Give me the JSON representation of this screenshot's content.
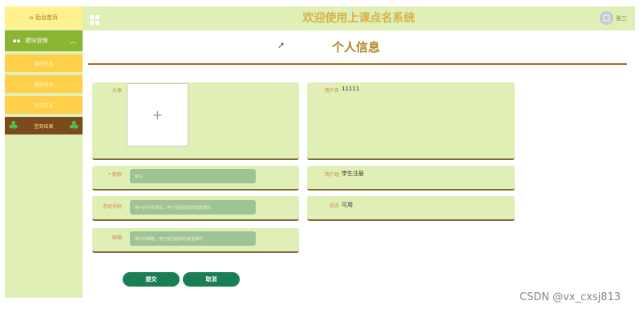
{
  "sidebar": {
    "home_label": "后台首页",
    "group_label": "模块管理",
    "items": [
      "课程信息",
      "课程签到",
      "补签信息",
      "签到结果"
    ]
  },
  "header": {
    "title": "欢迎使用上课点名系统",
    "user_name": "张三"
  },
  "page": {
    "title": "个人信息"
  },
  "form": {
    "avatar_label": "头像",
    "avatar_upload_symbol": "+",
    "username_label": "用户名",
    "username_value": "11111",
    "nickname_label": "* 昵称",
    "nickname_value": "张三",
    "usergroup_label": "用户组",
    "usergroup_value": "学生注册",
    "phone_label": "手机号码",
    "phone_placeholder": "用户的手机号码，用于找回密码时或登录时",
    "status_label": "状态",
    "status_value": "可用",
    "email_label": "邮箱",
    "email_placeholder": "用户的邮箱，用于找回密码时或登录时",
    "submit_label": "提交",
    "cancel_label": "取消"
  },
  "watermark": "CSDN @vx_cxsj813"
}
